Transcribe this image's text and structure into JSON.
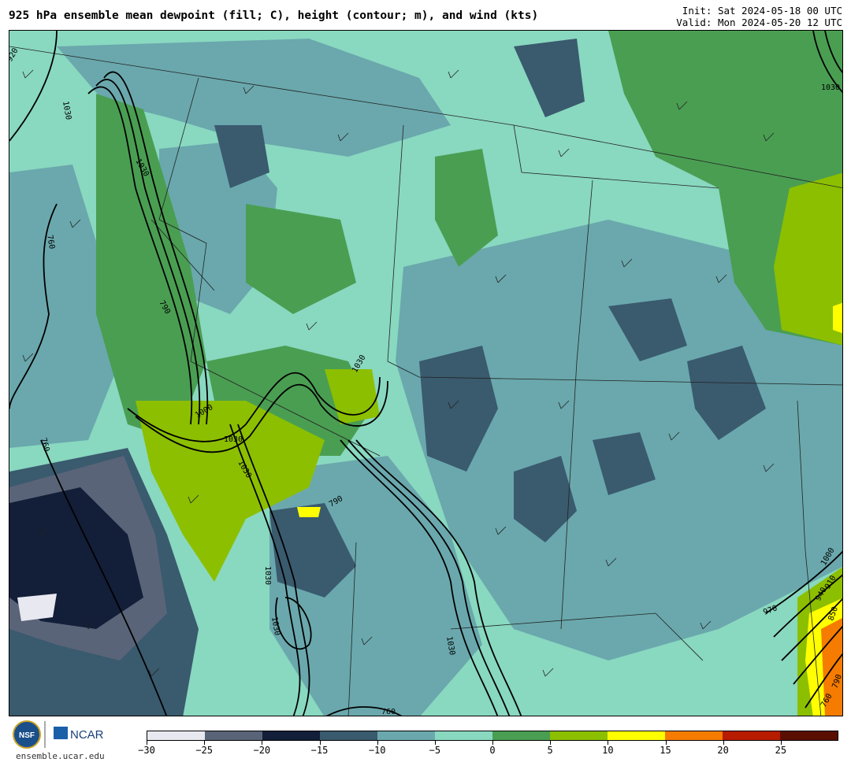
{
  "header": {
    "title": "925 hPa ensemble mean dewpoint (fill; C), height (contour; m), and wind (kts)",
    "init": "Init: Sat 2024-05-18 00 UTC",
    "valid": "Valid: Mon 2024-05-20 12 UTC"
  },
  "map": {
    "contour_labels": [
      "920",
      "1030",
      "760",
      "790",
      "1030",
      "1000",
      "1030",
      "1030",
      "1030",
      "790",
      "1030",
      "1030",
      "760",
      "1030",
      "760",
      "1000",
      "910",
      "940",
      "970",
      "850",
      "790",
      "760",
      "1030"
    ]
  },
  "colorbar": {
    "ticks": [
      "−30",
      "−25",
      "−20",
      "−15",
      "−10",
      "−5",
      "0",
      "5",
      "10",
      "15",
      "20",
      "25"
    ],
    "colors": [
      "#e8e8f0",
      "#5a6478",
      "#131e38",
      "#3a5a6e",
      "#6aa8ad",
      "#89d8c0",
      "#4a9e52",
      "#8cbf00",
      "#ffff00",
      "#f57c00",
      "#b71c00",
      "#5a0e00"
    ]
  },
  "footer": {
    "org": "NCAR",
    "url": "ensemble.ucar.edu"
  }
}
